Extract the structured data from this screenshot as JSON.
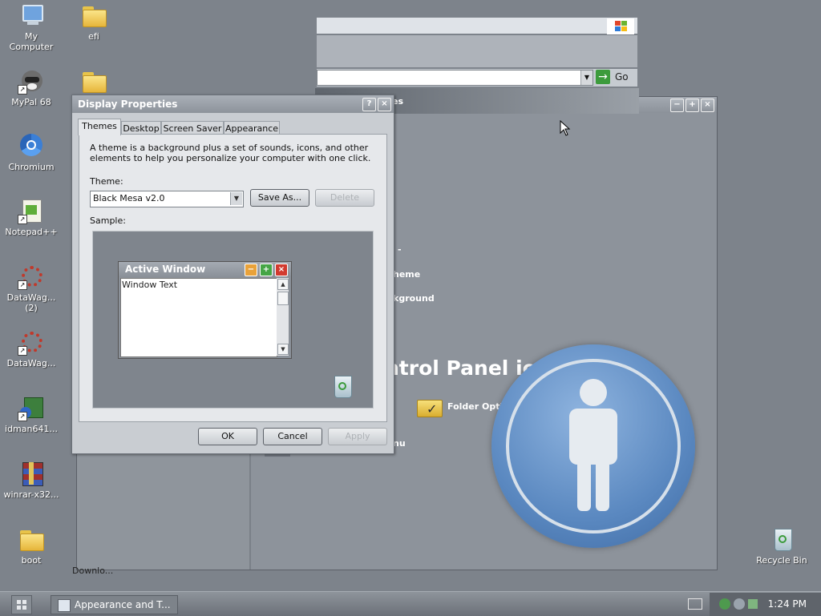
{
  "desktop": {
    "icons": [
      {
        "label": "My\nComputer",
        "icon": "computer-icon"
      },
      {
        "label": "efi",
        "icon": "folder-icon"
      },
      {
        "label": "MyPal 68",
        "icon": "raccoon-icon"
      },
      {
        "label": "",
        "icon": "folder-icon"
      },
      {
        "label": "Chromium",
        "icon": "chromium-icon"
      },
      {
        "label": "Notepad++",
        "icon": "notepad-plus-plus-icon"
      },
      {
        "label": "DataWag...\n(2)",
        "icon": "datawag-icon"
      },
      {
        "label": "DataWag...",
        "icon": "datawag-icon"
      },
      {
        "label": "idman641...",
        "icon": "idman-icon"
      },
      {
        "label": "winrar-x32...",
        "icon": "winrar-icon"
      },
      {
        "label": "boot",
        "icon": "folder-icon"
      },
      {
        "label": "Downlo...",
        "icon": "folder-icon"
      },
      {
        "label": "Recycle Bin",
        "icon": "recycle-bin-icon"
      }
    ]
  },
  "explorer": {
    "go_label": "Go",
    "fragments": {
      "section_head": "es",
      "dash": "-",
      "theme": "heme",
      "background": "kground",
      "control_panel_icon": "ntrol Panel icon",
      "folder_options": "Folder Options",
      "menu": "nu"
    }
  },
  "dialog": {
    "title": "Display Properties",
    "tabs": [
      "Themes",
      "Desktop",
      "Screen Saver",
      "Appearance"
    ],
    "description": "A theme is a background plus a set of sounds, icons, and other elements to help you personalize your computer with one click.",
    "theme_label": "Theme:",
    "theme_value": "Black Mesa v2.0",
    "save_as": "Save As...",
    "delete": "Delete",
    "sample_label": "Sample:",
    "sample_window_title": "Active Window",
    "sample_window_text": "Window Text",
    "ok": "OK",
    "cancel": "Cancel",
    "apply": "Apply"
  },
  "taskbar": {
    "task_label": "Appearance and T...",
    "clock": "1:24 PM"
  }
}
